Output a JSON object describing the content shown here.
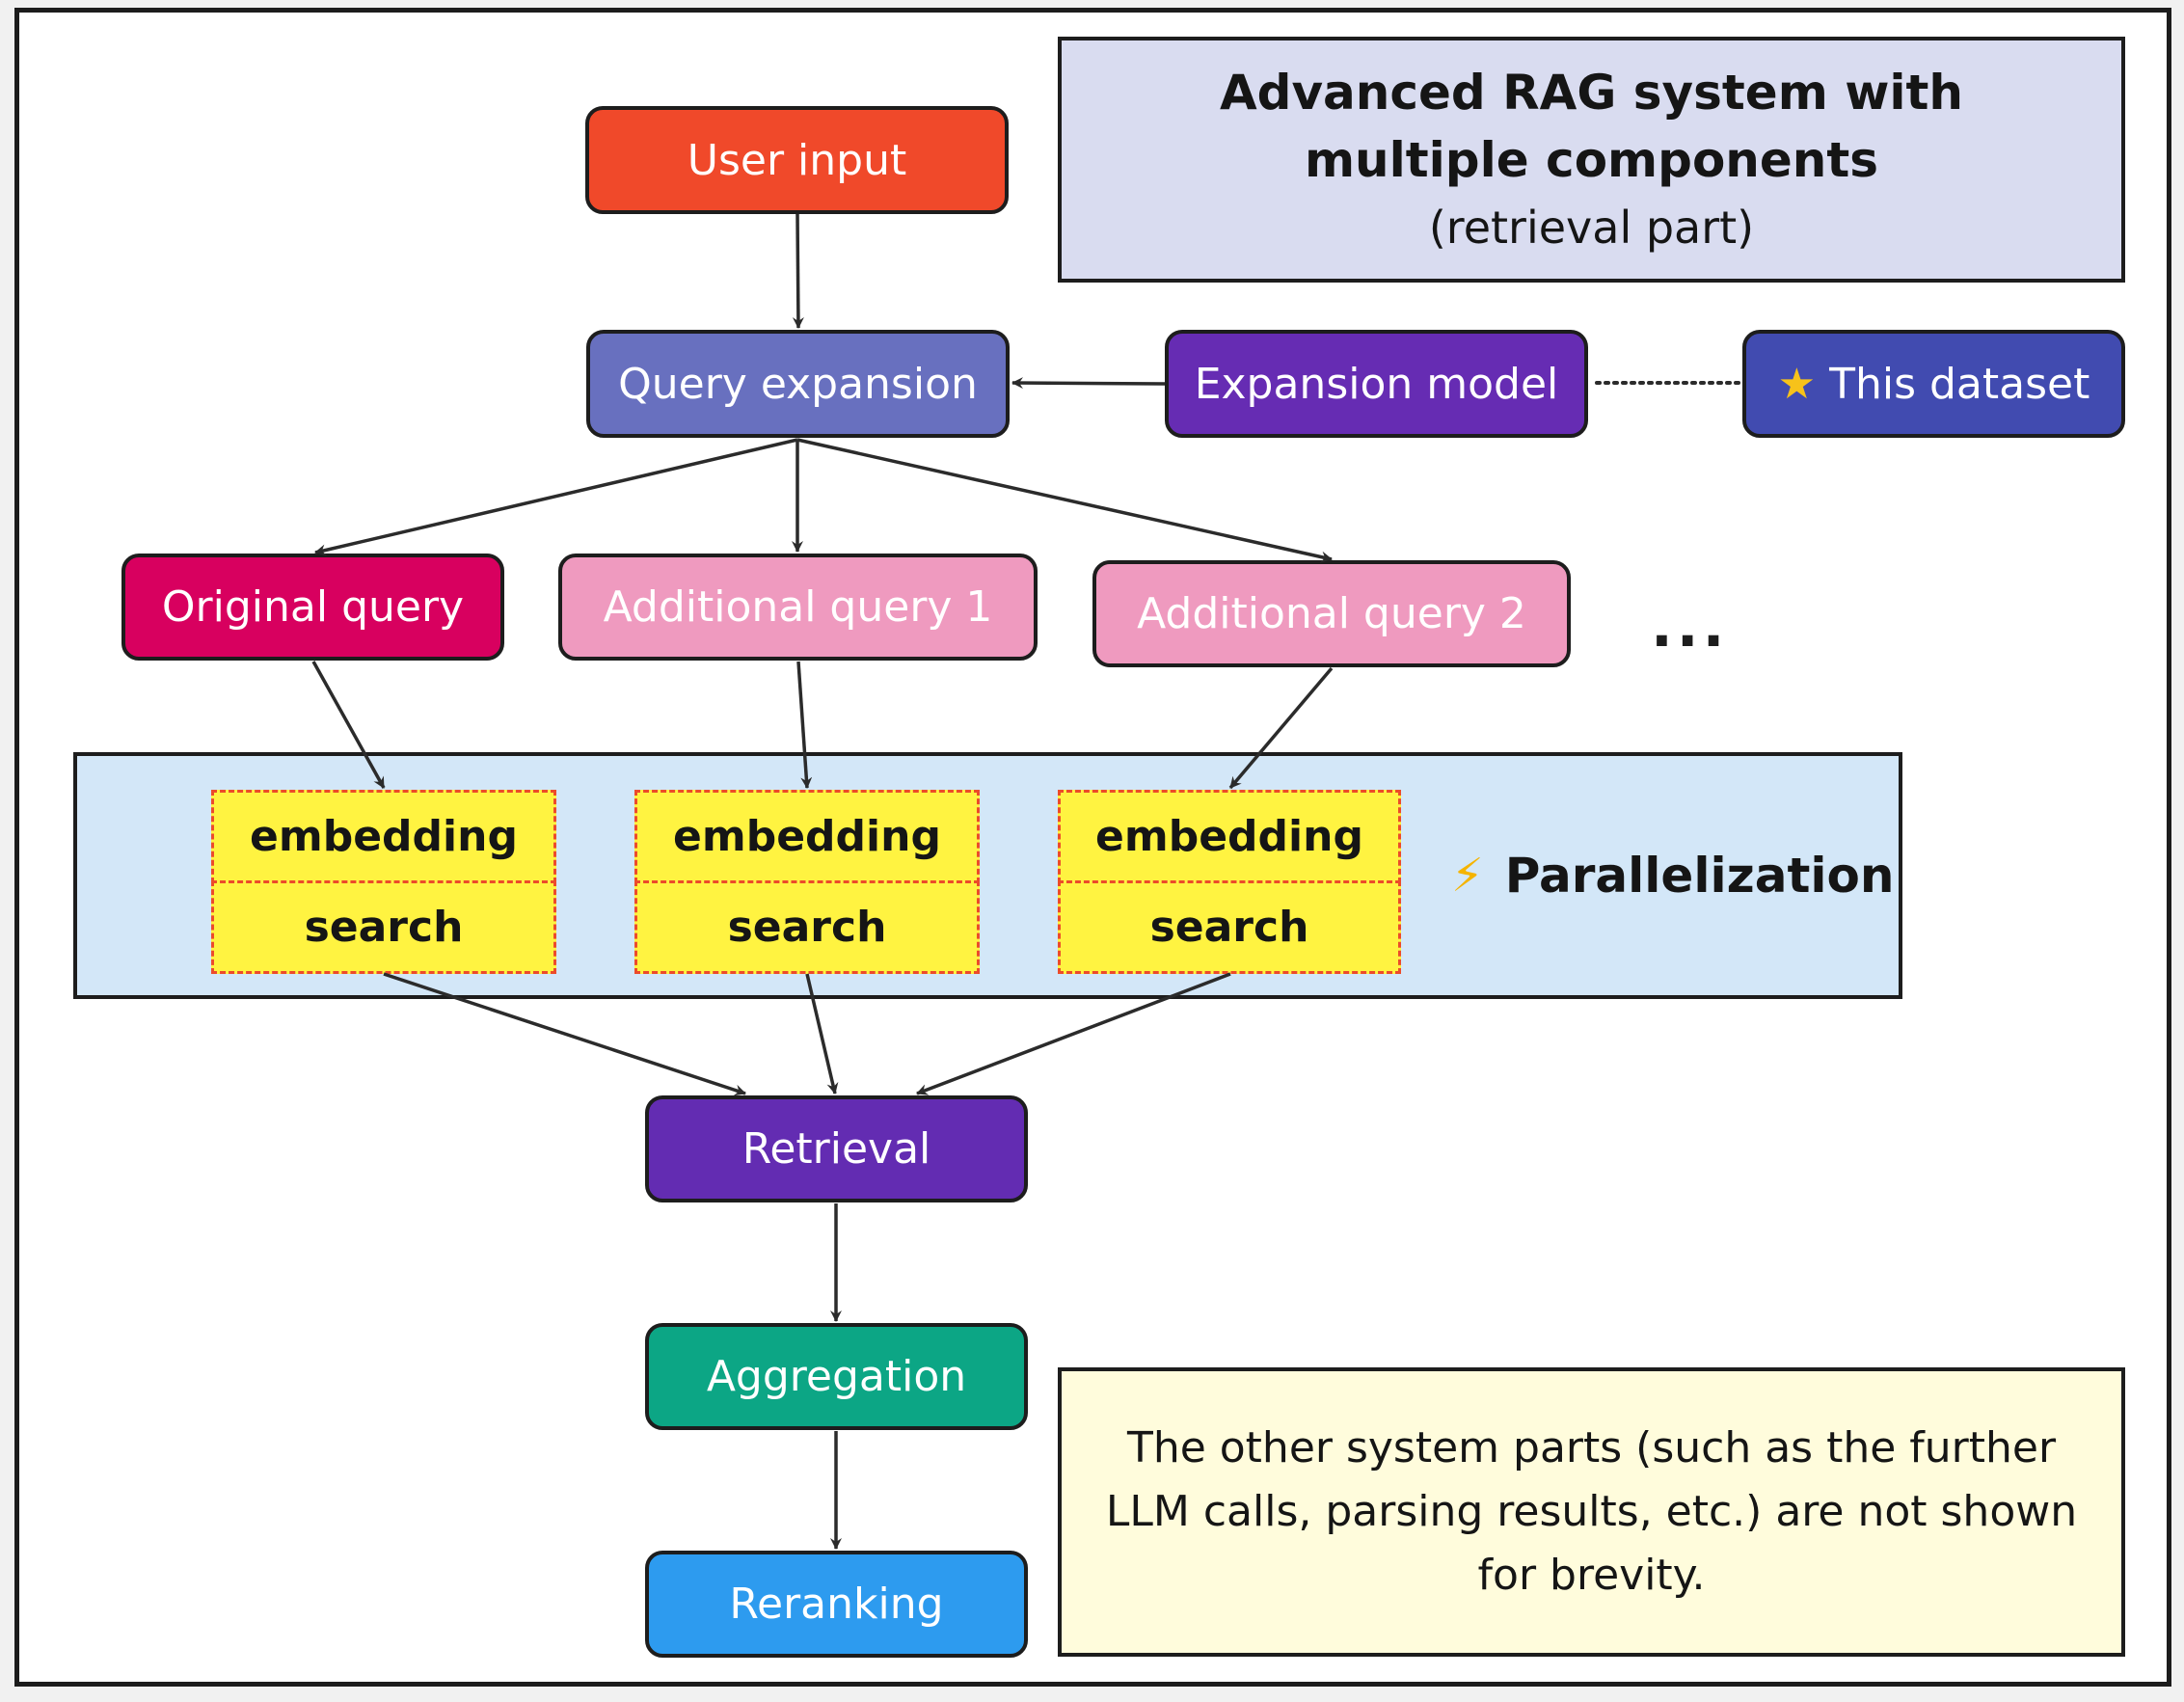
{
  "title": {
    "main": "Advanced RAG system with multiple components",
    "sub": "(retrieval part)"
  },
  "nodes": {
    "user_input": "User input",
    "query_expansion": "Query expansion",
    "expansion_model": "Expansion model",
    "this_dataset": "This dataset",
    "original_query": "Original query",
    "additional_query_1": "Additional query 1",
    "additional_query_2": "Additional query 2",
    "more_queries": "...",
    "retrieval": "Retrieval",
    "aggregation": "Aggregation",
    "reranking": "Reranking"
  },
  "icons": {
    "this_dataset": "star-icon",
    "parallelization": "lightning-bolt-icon"
  },
  "parallel_group": {
    "label": "Parallelization",
    "columns": [
      {
        "embedding": "embedding",
        "search": "search"
      },
      {
        "embedding": "embedding",
        "search": "search"
      },
      {
        "embedding": "embedding",
        "search": "search"
      }
    ]
  },
  "note": "The other system parts (such as the further LLM calls, parsing results, etc.) are not shown for brevity.",
  "colors": {
    "user_input": "#f0492a",
    "query_expansion": "#6870bf",
    "expansion_model": "#662cb3",
    "this_dataset": "#414bb0",
    "original_query": "#d8005f",
    "additional_query": "#ef9abf",
    "retrieval": "#632cb2",
    "aggregation": "#0ca685",
    "reranking": "#2d9bef",
    "title_bg": "#d9dcf0",
    "parallel_bg": "#d3e7f8",
    "step_bg": "#fff341",
    "step_border": "#ec4b2a",
    "note_bg": "#fffcdc"
  },
  "edges": [
    {
      "from": "User input",
      "to": "Query expansion",
      "style": "arrow"
    },
    {
      "from": "Expansion model",
      "to": "Query expansion",
      "style": "arrow"
    },
    {
      "from": "Expansion model",
      "to": "This dataset",
      "style": "dotted"
    },
    {
      "from": "Query expansion",
      "to": "Original query",
      "style": "arrow"
    },
    {
      "from": "Query expansion",
      "to": "Additional query 1",
      "style": "arrow"
    },
    {
      "from": "Query expansion",
      "to": "Additional query 2",
      "style": "arrow"
    },
    {
      "from": "Original query",
      "to": "embedding 1",
      "style": "arrow"
    },
    {
      "from": "Additional query 1",
      "to": "embedding 2",
      "style": "arrow"
    },
    {
      "from": "Additional query 2",
      "to": "embedding 3",
      "style": "arrow"
    },
    {
      "from": "search 1",
      "to": "Retrieval",
      "style": "arrow"
    },
    {
      "from": "search 2",
      "to": "Retrieval",
      "style": "arrow"
    },
    {
      "from": "search 3",
      "to": "Retrieval",
      "style": "arrow"
    },
    {
      "from": "Retrieval",
      "to": "Aggregation",
      "style": "arrow"
    },
    {
      "from": "Aggregation",
      "to": "Reranking",
      "style": "arrow"
    }
  ]
}
